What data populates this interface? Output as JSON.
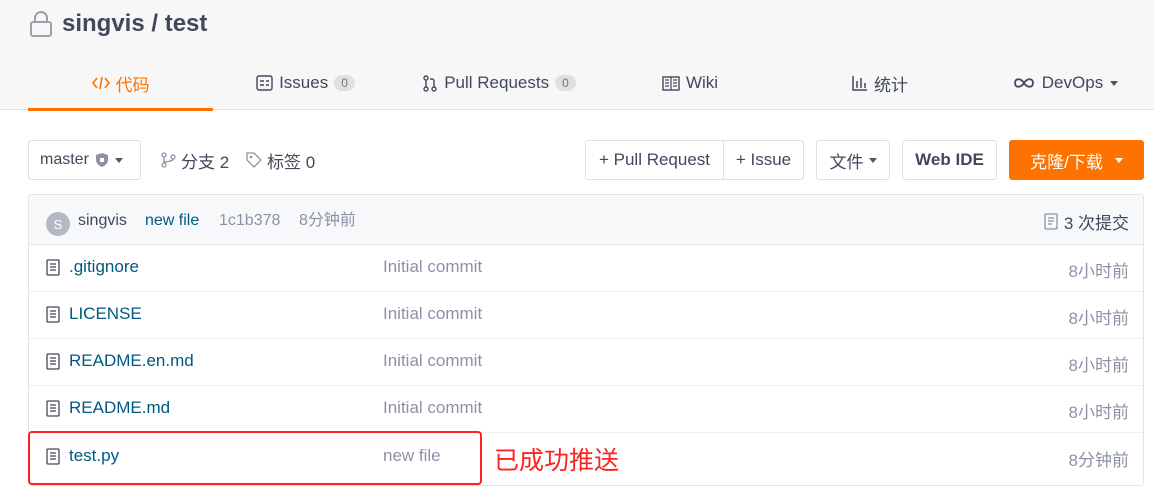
{
  "repo": {
    "title": "singvis / test"
  },
  "tabs": [
    {
      "label": "代码",
      "icon": "code-icon",
      "active": true
    },
    {
      "label": "Issues",
      "icon": "issues-icon",
      "badge": "0"
    },
    {
      "label": "Pull Requests",
      "icon": "pull-request-icon",
      "badge": "0"
    },
    {
      "label": "Wiki",
      "icon": "book-icon"
    },
    {
      "label": "统计",
      "icon": "bar-chart-icon"
    },
    {
      "label": "DevOps",
      "icon": "infinity-icon",
      "dropdown": true
    }
  ],
  "toolbar": {
    "branch": "master",
    "branches_label": "分支 2",
    "tags_label": "标签 0",
    "pull_request_button": "+ Pull Request",
    "issue_button": "+ Issue",
    "file_button": "文件",
    "webide_button": "Web IDE",
    "clone_button": "克隆/下载"
  },
  "latest_commit": {
    "avatar_letter": "S",
    "author": "singvis",
    "message": "new file",
    "sha": "1c1b378",
    "time": "8分钟前",
    "count_label": "3 次提交"
  },
  "files": [
    {
      "name": ".gitignore",
      "message": "Initial commit",
      "time": "8小时前"
    },
    {
      "name": "LICENSE",
      "message": "Initial commit",
      "time": "8小时前"
    },
    {
      "name": "README.en.md",
      "message": "Initial commit",
      "time": "8小时前"
    },
    {
      "name": "README.md",
      "message": "Initial commit",
      "time": "8小时前"
    },
    {
      "name": "test.py",
      "message": "new file",
      "time": "8分钟前"
    }
  ],
  "annotation": {
    "text": "已成功推送",
    "color": "#ff2222"
  },
  "colors": {
    "accent": "#fe7300",
    "link": "#005980",
    "muted": "#8c92a4"
  }
}
